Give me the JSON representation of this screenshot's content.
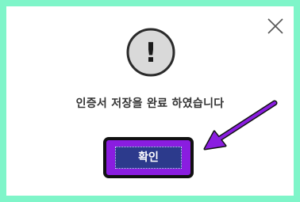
{
  "dialog": {
    "message": "인증서 저장을 완료 하였습니다",
    "confirm_label": "확인",
    "alert_symbol": "!",
    "icons": {
      "close": "close-icon",
      "alert": "exclamation-circle-icon",
      "annotation": "arrow-pointer"
    }
  },
  "colors": {
    "background": "#7ff5c9",
    "button": "#2c3a8c",
    "highlight": "#8a1de0",
    "arrow": "#8a1de0"
  }
}
